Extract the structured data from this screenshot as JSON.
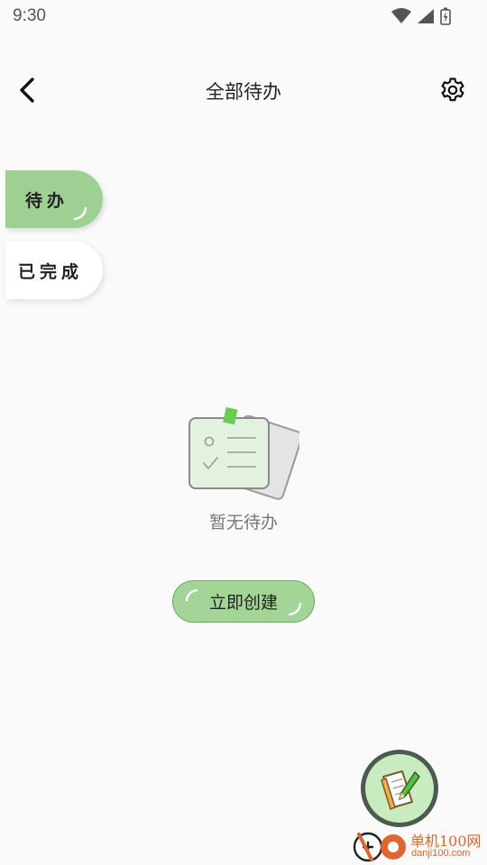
{
  "status_bar": {
    "time": "9:30",
    "icons": [
      "wifi-icon",
      "signal-icon",
      "battery-charging-icon"
    ]
  },
  "header": {
    "title": "全部待办",
    "back_icon": "chevron-left-icon",
    "settings_icon": "gear-icon"
  },
  "tabs": [
    {
      "label": "待办",
      "selected": true
    },
    {
      "label": "已完成",
      "selected": false
    }
  ],
  "empty_state": {
    "illustration": "empty-note-icon",
    "text": "暂无待办"
  },
  "create_button": {
    "label": "立即创建"
  },
  "fab": {
    "icon": "note-pencil-icon"
  },
  "watermark": {
    "text": "单机100网",
    "subtext": "danji100.com"
  },
  "colors": {
    "accent_green": "#9ed093",
    "button_border": "#6fa864",
    "background": "#fafafa",
    "fab_ring": "#4d5a4f",
    "fab_fill": "#c8ecc0",
    "watermark": "#e0662f"
  }
}
